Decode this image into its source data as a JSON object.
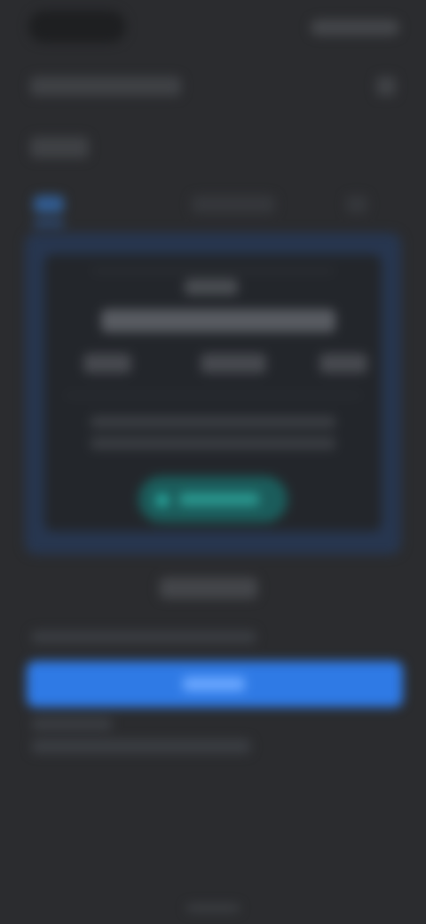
{
  "ui": {
    "background": "#2b2c2f",
    "accent": "#2f7ae5",
    "teal": "#2ab3a7",
    "frame_tint": "#27364f"
  },
  "icons": {
    "header_right": "settings-icon",
    "action_leading": "dot-icon"
  },
  "text": {
    "header_title": "",
    "subheader": "",
    "tabs": [
      "",
      "",
      ""
    ],
    "card_label": "",
    "card_headline": "",
    "card_columns": [
      "",
      "",
      ""
    ],
    "card_description": [
      "",
      ""
    ],
    "action_label": "",
    "under_title": "",
    "under_line": "",
    "primary_button_label": "",
    "meta_line_1": "",
    "meta_line_2": ""
  }
}
